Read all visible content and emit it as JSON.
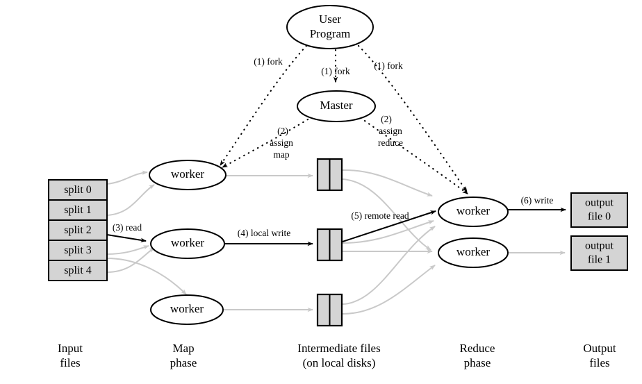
{
  "figure": {
    "title": "MapReduce Execution Overview"
  },
  "nodes": {
    "user_program": {
      "line1": "User",
      "line2": "Program"
    },
    "master": {
      "label": "Master"
    },
    "map_workers": [
      {
        "label": "worker"
      },
      {
        "label": "worker"
      },
      {
        "label": "worker"
      }
    ],
    "reduce_workers": [
      {
        "label": "worker"
      },
      {
        "label": "worker"
      }
    ]
  },
  "input_splits": [
    {
      "label": "split 0"
    },
    {
      "label": "split 1"
    },
    {
      "label": "split 2"
    },
    {
      "label": "split 3"
    },
    {
      "label": "split 4"
    }
  ],
  "intermediate_files": [
    {
      "label": ""
    },
    {
      "label": ""
    },
    {
      "label": ""
    }
  ],
  "output_files": [
    {
      "line1": "output",
      "line2": "file 0"
    },
    {
      "line1": "output",
      "line2": "file 1"
    }
  ],
  "edge_labels": {
    "fork_left": "(1) fork",
    "fork_center": "(1) fork",
    "fork_right": "(1) fork",
    "assign_map_num": "(2)",
    "assign_map_l1": "assign",
    "assign_map_l2": "map",
    "assign_reduce_num": "(2)",
    "assign_reduce_l1": "assign",
    "assign_reduce_l2": "reduce",
    "read": "(3) read",
    "local_write": "(4) local write",
    "remote_read": "(5) remote read",
    "write": "(6) write"
  },
  "phase_labels": [
    {
      "line1": "Input",
      "line2": "files"
    },
    {
      "line1": "Map",
      "line2": "phase"
    },
    {
      "line1": "Intermediate files",
      "line2": "(on local disks)"
    },
    {
      "line1": "Reduce",
      "line2": "phase"
    },
    {
      "line1": "Output",
      "line2": "files"
    }
  ],
  "colors": {
    "box_fill": "#d4d4d4",
    "stroke": "#000000",
    "grey_edge": "#c9c9c9",
    "background": "#ffffff"
  }
}
